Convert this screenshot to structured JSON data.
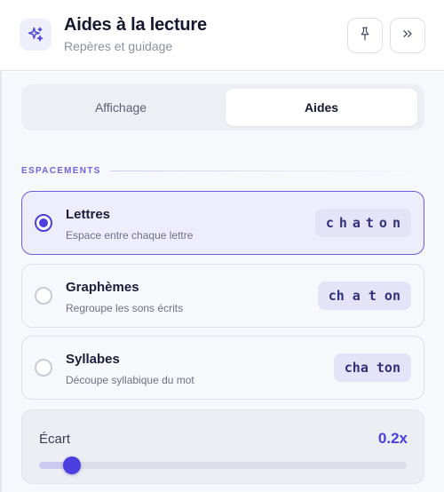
{
  "header": {
    "title": "Aides à la lecture",
    "subtitle": "Repères et guidage",
    "icon": "sparkles-icon",
    "buttons": [
      {
        "name": "pin-button",
        "icon": "pin-icon"
      },
      {
        "name": "collapse-button",
        "icon": "double-chevron-right-icon"
      }
    ]
  },
  "tabs": [
    {
      "label": "Affichage",
      "active": false
    },
    {
      "label": "Aides",
      "active": true
    }
  ],
  "section": {
    "title": "ESPACEMENTS"
  },
  "options": [
    {
      "label": "Lettres",
      "description": "Espace entre chaque lettre",
      "sample": "chaton",
      "selected": true
    },
    {
      "label": "Graphèmes",
      "description": "Regroupe les sons écrits",
      "sample": "ch a t on",
      "selected": false
    },
    {
      "label": "Syllabes",
      "description": "Découpe syllabique du mot",
      "sample": "cha ton",
      "selected": false
    }
  ],
  "slider": {
    "label": "Écart",
    "value_text": "0.2x",
    "level": 0.09
  },
  "colors": {
    "accent": "#4b3fe0",
    "selected_bg": "#eeedfb",
    "section_title": "#6d64d6"
  }
}
